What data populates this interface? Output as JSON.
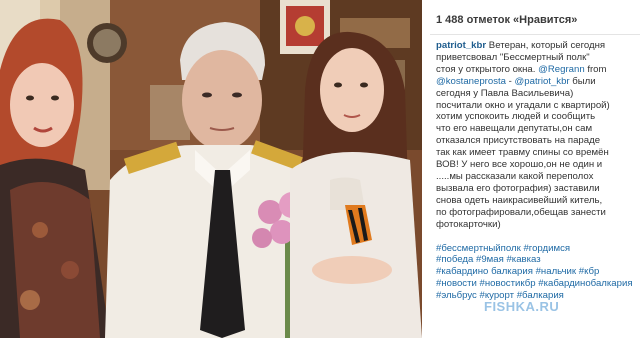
{
  "post": {
    "likes_text": "1 488 отметок «Нравится»",
    "author": "patriot_kbr",
    "caption_lines": [
      [
        {
          "t": "Ветеран, который сегодня",
          "k": "text"
        }
      ],
      [
        {
          "t": "приветсвовал \"Бессмертный полк\"",
          "k": "text"
        }
      ],
      [
        {
          "t": "стоя у открытого окна. ",
          "k": "text"
        },
        {
          "t": "@Regrann",
          "k": "link"
        },
        {
          "t": " from",
          "k": "text"
        }
      ],
      [
        {
          "t": "@kostaneprosta",
          "k": "link"
        },
        {
          "t": " - ",
          "k": "text"
        },
        {
          "t": "@patriot_kbr",
          "k": "link"
        },
        {
          "t": " были",
          "k": "text"
        }
      ],
      [
        {
          "t": "сегодня у Павла Васильевича)",
          "k": "text"
        }
      ],
      [
        {
          "t": "посчитали окно и угадали с квартирой)",
          "k": "text"
        }
      ],
      [
        {
          "t": "хотим успокоить людей и сообщить",
          "k": "text"
        }
      ],
      [
        {
          "t": "что его навещали депутаты,он сам",
          "k": "text"
        }
      ],
      [
        {
          "t": "отказался присутствовать на параде",
          "k": "text"
        }
      ],
      [
        {
          "t": "так как имеет травму спины со времён",
          "k": "text"
        }
      ],
      [
        {
          "t": "ВОВ! У него все хорошо,он не один и",
          "k": "text"
        }
      ],
      [
        {
          "t": ".....мы рассказали какой переполох",
          "k": "text"
        }
      ],
      [
        {
          "t": "вызвала его фотография) заставили",
          "k": "text"
        }
      ],
      [
        {
          "t": "снова одеть наикрасивейший китель,",
          "k": "text"
        }
      ],
      [
        {
          "t": "по фотографировали,обещав занести",
          "k": "text"
        }
      ],
      [
        {
          "t": "фотокарточки)",
          "k": "text"
        }
      ]
    ],
    "hashtag_lines": [
      [
        "#бессмертныйполк",
        "#гордимся"
      ],
      [
        "#победа",
        "#9мая",
        "#кавказ"
      ],
      [
        "#кабардино",
        "балкария",
        "#нальчик",
        "#кбр"
      ],
      [
        "#новости",
        "#новостикбр",
        "#кабардинобалкария"
      ],
      [
        "#эльбрус",
        "#курорт",
        "#балкария"
      ]
    ]
  },
  "watermark": "FISHKA.RU",
  "colors": {
    "link": "#1f6aa5",
    "text": "#333333",
    "likes": "#3a3a3a"
  }
}
